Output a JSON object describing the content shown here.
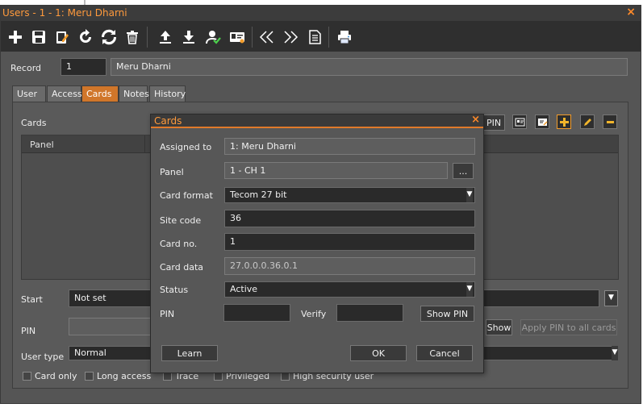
{
  "window": {
    "title": "Users - 1 - 1: Meru Dharni",
    "close": "×"
  },
  "toolbar": {
    "icons": [
      "plus-icon",
      "save-icon",
      "edit-icon",
      "refresh-icon",
      "reload-icon",
      "trash-icon",
      "upload-icon",
      "download-icon",
      "user-check-icon",
      "id-card-icon",
      "prev-icon",
      "next-icon",
      "document-icon",
      "print-icon"
    ]
  },
  "record": {
    "label": "Record",
    "id": "1",
    "name": "Meru Dharni"
  },
  "tabs": [
    {
      "label": "User"
    },
    {
      "label": "Access"
    },
    {
      "label": "Cards",
      "active": true
    },
    {
      "label": "Notes"
    },
    {
      "label": "History"
    }
  ],
  "cards_section": {
    "label": "Cards",
    "grid_header_panel": "Panel",
    "pin_button": "PIN"
  },
  "form": {
    "start_label": "Start",
    "start_value": "Not set",
    "pin_label": "PIN",
    "show_button": "Show",
    "apply_pin_button": "Apply PIN to all cards",
    "user_type_label": "User type",
    "user_type_value": "Normal",
    "checkboxes": [
      {
        "label": "Card only"
      },
      {
        "label": "Long access"
      },
      {
        "label": "Trace"
      },
      {
        "label": "Privileged"
      },
      {
        "label": "High security user"
      }
    ]
  },
  "dialog": {
    "title": "Cards",
    "close": "×",
    "assigned_to_label": "Assigned to",
    "assigned_to_value": "1: Meru Dharni",
    "panel_label": "Panel",
    "panel_value": "1 - CH 1",
    "panel_browse": "...",
    "card_format_label": "Card format",
    "card_format_value": "Tecom 27 bit",
    "site_code_label": "Site code",
    "site_code_value": "36",
    "card_no_label": "Card no.",
    "card_no_value": "1",
    "card_data_label": "Card data",
    "card_data_value": "27.0.0.0.36.0.1",
    "status_label": "Status",
    "status_value": "Active",
    "pin_label": "PIN",
    "verify_label": "Verify",
    "show_pin_button": "Show PIN",
    "learn_button": "Learn",
    "ok_button": "OK",
    "cancel_button": "Cancel"
  },
  "colors": {
    "accent": "#d0762a",
    "title": "#ff9a3c",
    "background": "#555555"
  }
}
